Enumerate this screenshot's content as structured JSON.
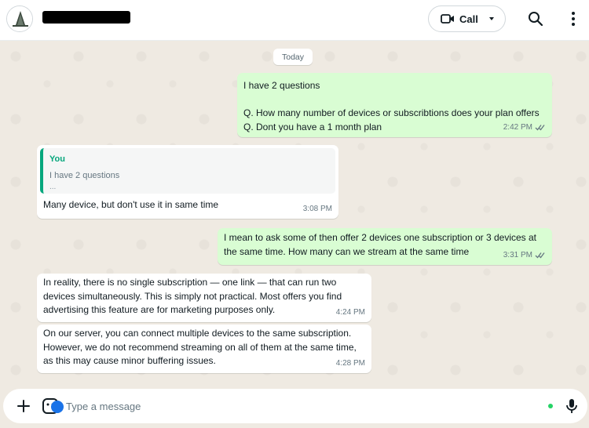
{
  "header": {
    "contact_name": "redacted",
    "call_label": "Call"
  },
  "chat": {
    "date_chip": "Today",
    "messages": [
      {
        "lines": [
          "I have 2 questions",
          "",
          "Q. How many number of devices or subscribtions does your plan offers",
          "Q. Dont you have a 1 month plan"
        ],
        "time": "2:42 PM"
      },
      {
        "quote_author": "You",
        "quote_text": "I have 2 questions",
        "quote_more": "...",
        "text": "Many device, but don't use it in  same time",
        "time": "3:08 PM"
      },
      {
        "lines": [
          "I mean to ask some of then offer 2 devices one subscription or 3 devices at",
          "the same time. How many can we stream at the same time"
        ],
        "time": "3:31 PM"
      },
      {
        "lines": [
          "In reality, there is no single subscription — one link — that can run two",
          "devices simultaneously. This is simply not practical. Most offers you find",
          "advertising this feature are for marketing purposes only."
        ],
        "time": "4:24 PM"
      },
      {
        "lines": [
          "On our server, you can connect multiple devices to the same subscription.",
          "However, we do not recommend streaming on all of them at the same time,",
          "as this may cause minor buffering issues."
        ],
        "time": "4:28 PM"
      }
    ]
  },
  "footer": {
    "placeholder": "Type a message"
  },
  "colors": {
    "outgoing": "#d9fdd3",
    "incoming": "#ffffff",
    "accent": "#06a77d",
    "read_ticks": "#53bdeb"
  },
  "icons": [
    "avatar",
    "video-camera-icon",
    "chevron-down-icon",
    "search-icon",
    "menu-dots-icon",
    "plus-icon",
    "sticker-icon",
    "mic-icon",
    "double-check-icon"
  ]
}
